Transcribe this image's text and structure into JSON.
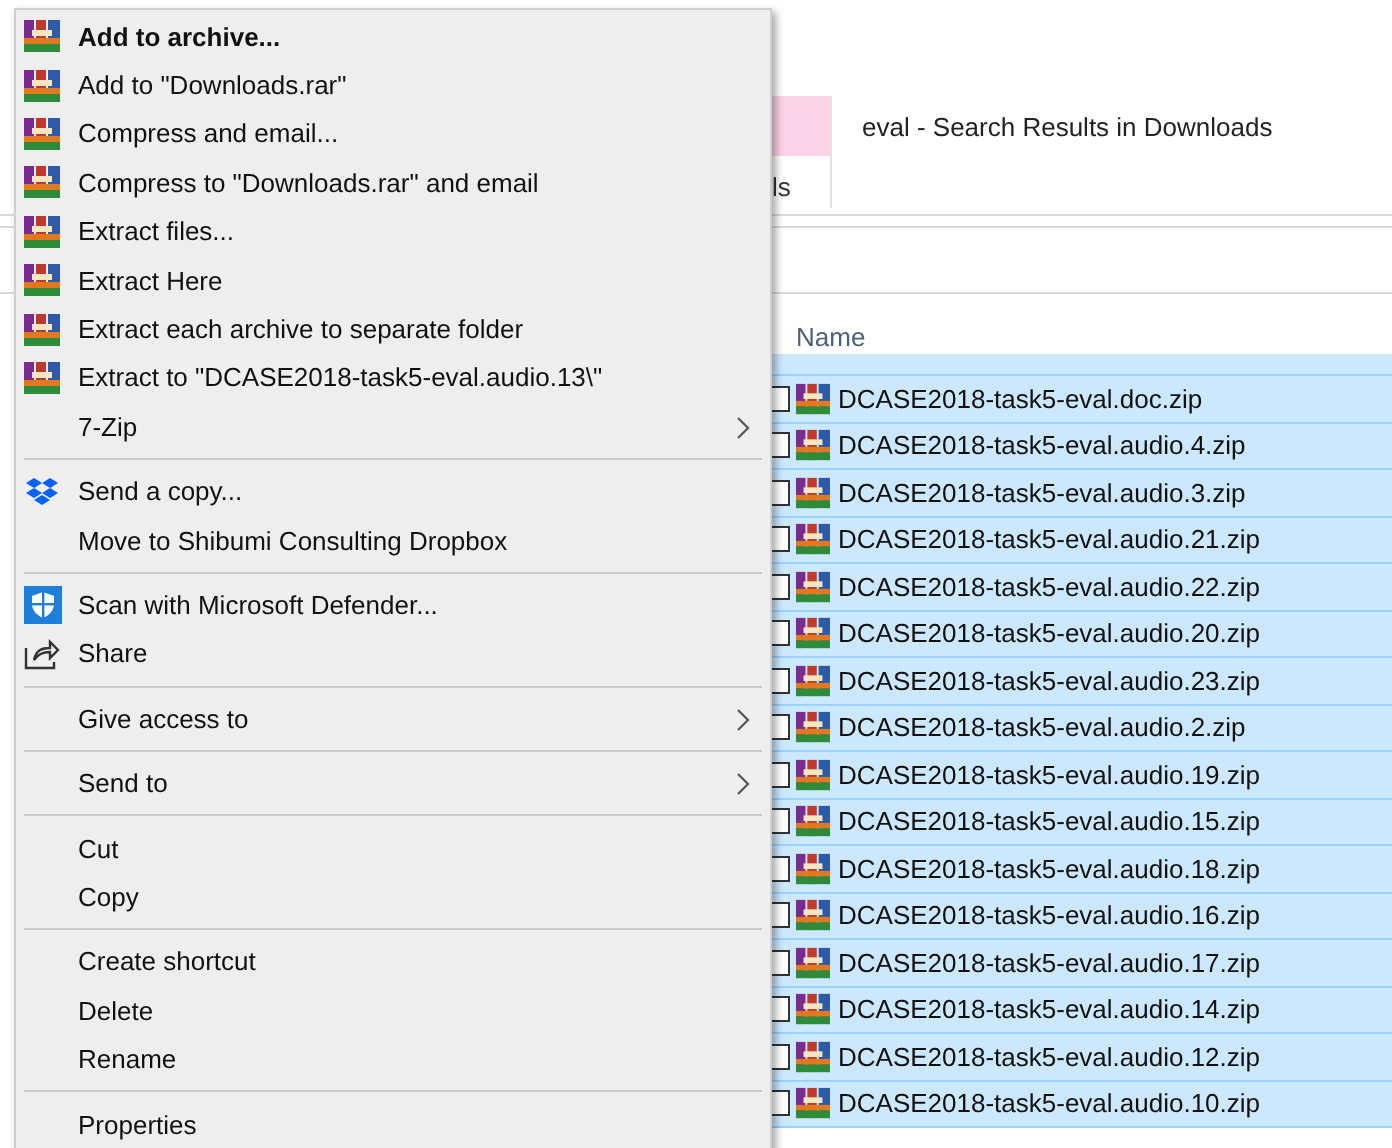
{
  "explorer": {
    "tab_fragment": "ls",
    "title": "eval - Search Results in Downloads",
    "column_header": "Name",
    "rows": [
      {
        "name": "DCASE2018-task5-eval.doc.zip",
        "selected": true
      },
      {
        "name": "DCASE2018-task5-eval.audio.4.zip",
        "selected": true
      },
      {
        "name": "DCASE2018-task5-eval.audio.3.zip",
        "selected": true
      },
      {
        "name": "DCASE2018-task5-eval.audio.21.zip",
        "selected": true
      },
      {
        "name": "DCASE2018-task5-eval.audio.22.zip",
        "selected": true
      },
      {
        "name": "DCASE2018-task5-eval.audio.20.zip",
        "selected": true
      },
      {
        "name": "DCASE2018-task5-eval.audio.23.zip",
        "selected": true
      },
      {
        "name": "DCASE2018-task5-eval.audio.2.zip",
        "selected": true
      },
      {
        "name": "DCASE2018-task5-eval.audio.19.zip",
        "selected": true
      },
      {
        "name": "DCASE2018-task5-eval.audio.15.zip",
        "selected": true
      },
      {
        "name": "DCASE2018-task5-eval.audio.18.zip",
        "selected": true
      },
      {
        "name": "DCASE2018-task5-eval.audio.16.zip",
        "selected": true
      },
      {
        "name": "DCASE2018-task5-eval.audio.17.zip",
        "selected": true
      },
      {
        "name": "DCASE2018-task5-eval.audio.14.zip",
        "selected": true
      },
      {
        "name": "DCASE2018-task5-eval.audio.12.zip",
        "selected": true
      },
      {
        "name": "DCASE2018-task5-eval.audio.10.zip",
        "selected": true
      }
    ]
  },
  "context_menu": {
    "items": [
      {
        "kind": "archive_default",
        "label": "Add to archive..."
      },
      {
        "kind": "archive",
        "label": "Add to \"Downloads.rar\""
      },
      {
        "kind": "archive",
        "label": "Compress and email..."
      },
      {
        "kind": "archive",
        "label": "Compress to \"Downloads.rar\" and email"
      },
      {
        "kind": "archive",
        "label": "Extract files..."
      },
      {
        "kind": "archive",
        "label": "Extract Here"
      },
      {
        "kind": "archive",
        "label": "Extract each archive to separate folder"
      },
      {
        "kind": "archive",
        "label": "Extract to \"DCASE2018-task5-eval.audio.13\\\""
      },
      {
        "kind": "submenu",
        "label": "7-Zip"
      },
      {
        "kind": "separator"
      },
      {
        "kind": "dropbox",
        "label": "Send a copy..."
      },
      {
        "kind": "plain",
        "label": "Move to Shibumi Consulting Dropbox"
      },
      {
        "kind": "separator"
      },
      {
        "kind": "defender",
        "label": "Scan with Microsoft Defender..."
      },
      {
        "kind": "share",
        "label": "Share"
      },
      {
        "kind": "separator"
      },
      {
        "kind": "submenu",
        "label": "Give access to"
      },
      {
        "kind": "separator"
      },
      {
        "kind": "submenu",
        "label": "Send to"
      },
      {
        "kind": "separator"
      },
      {
        "kind": "plain",
        "label": "Cut"
      },
      {
        "kind": "plain",
        "label": "Copy"
      },
      {
        "kind": "separator"
      },
      {
        "kind": "plain",
        "label": "Create shortcut"
      },
      {
        "kind": "plain",
        "label": "Delete"
      },
      {
        "kind": "plain",
        "label": "Rename"
      },
      {
        "kind": "separator"
      },
      {
        "kind": "plain",
        "label": "Properties"
      }
    ]
  }
}
